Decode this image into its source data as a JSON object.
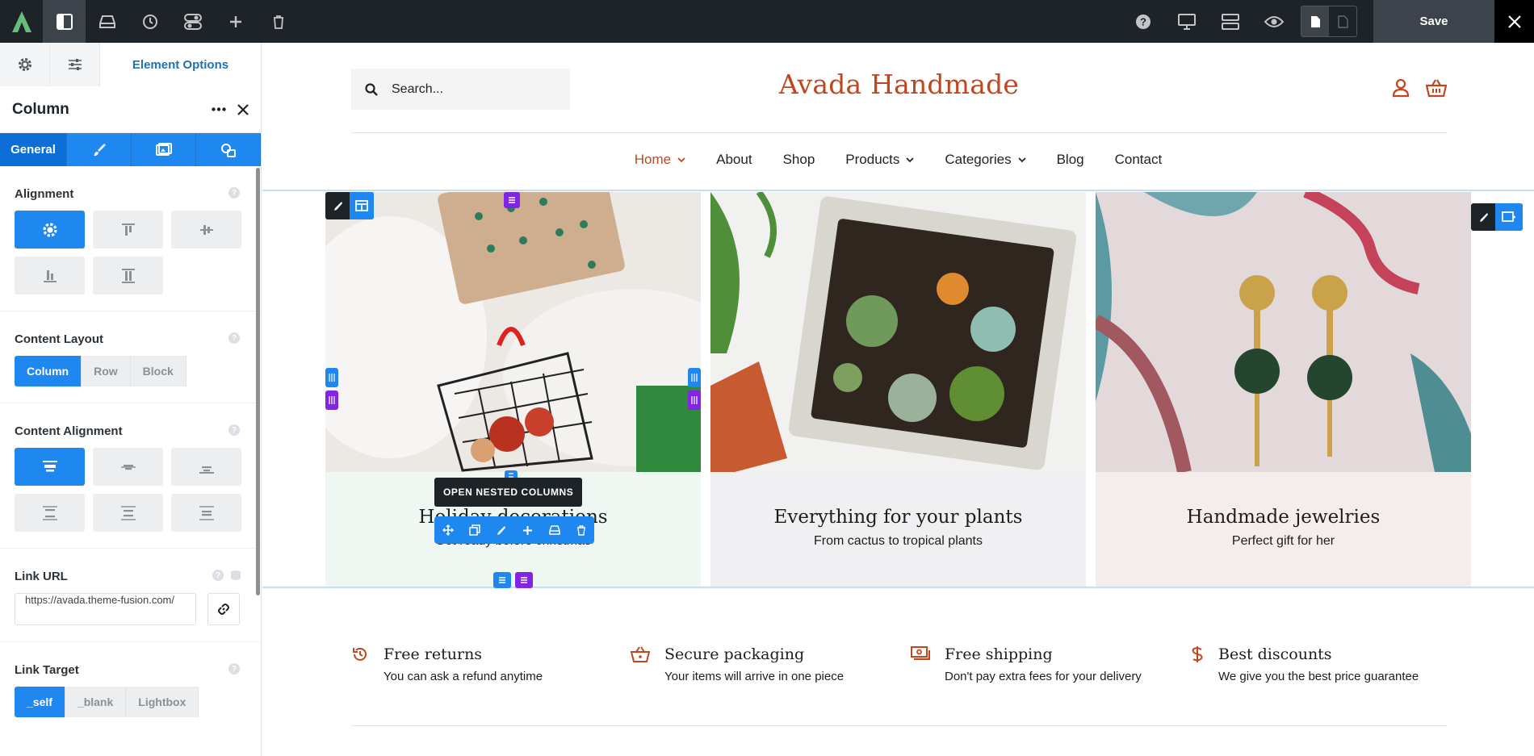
{
  "topbar": {
    "save_label": "Save",
    "icons_left": [
      "avada-logo-icon",
      "sidebar-toggle-icon",
      "library-icon",
      "history-icon",
      "toggle-settings-icon",
      "add-element-icon",
      "trash-icon"
    ],
    "icons_right": [
      "help-icon",
      "desktop-icon",
      "layout-icon",
      "preview-icon",
      "page-icon",
      "page-outline-icon",
      "close-icon"
    ]
  },
  "panel": {
    "tab_label": "Element Options",
    "title": "Column",
    "subtab_general": "General",
    "alignment": {
      "heading": "Alignment"
    },
    "content_layout": {
      "heading": "Content Layout",
      "options": [
        "Column",
        "Row",
        "Block"
      ],
      "selected": "Column"
    },
    "content_alignment": {
      "heading": "Content Alignment"
    },
    "link_url": {
      "heading": "Link URL",
      "value": "https://avada.theme-fusion.com/"
    },
    "link_target": {
      "heading": "Link Target",
      "options": [
        "_self",
        "_blank",
        "Lightbox"
      ],
      "selected": "_self"
    }
  },
  "site": {
    "search_placeholder": "Search...",
    "logo": "Avada Handmade",
    "nav": [
      "Home",
      "About",
      "Shop",
      "Products",
      "Categories",
      "Blog",
      "Contact"
    ],
    "nav_active": "Home",
    "tooltip": "OPEN NESTED COLUMNS",
    "columns": [
      {
        "title": "Holiday decorations",
        "subtitle": "Get ready before christmas"
      },
      {
        "title": "Everything for your plants",
        "subtitle": "From cactus to tropical plants"
      },
      {
        "title": "Handmade jewelries",
        "subtitle": "Perfect gift for her"
      }
    ],
    "features": [
      {
        "icon": "refund-clock-icon",
        "title": "Free returns",
        "text": "You can ask a refund anytime"
      },
      {
        "icon": "basket-icon",
        "title": "Secure packaging",
        "text": "Your items will arrive in one piece"
      },
      {
        "icon": "money-icon",
        "title": "Free shipping",
        "text": "Don't pay extra fees for your delivery"
      },
      {
        "icon": "dollar-icon",
        "title": "Best discounts",
        "text": "We give you the best price guarantee"
      }
    ]
  },
  "colors": {
    "accent": "#1e87f0",
    "brand": "#c0471d",
    "dark": "#1d2327",
    "purple": "#8224e3"
  }
}
